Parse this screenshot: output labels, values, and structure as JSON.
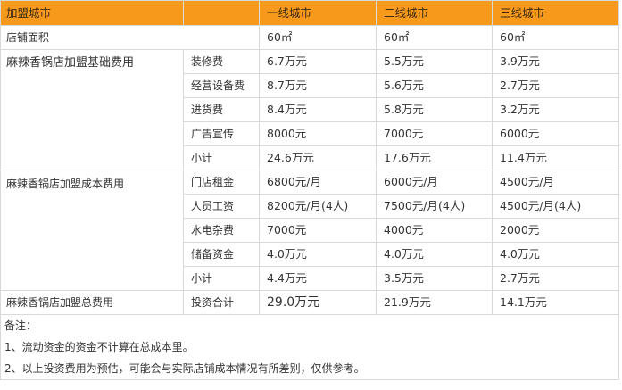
{
  "header": {
    "col0": "加盟城市",
    "col2": "一线城市",
    "col3": "二线城市",
    "col4": "三线城市"
  },
  "area_row": {
    "label": "店铺面积",
    "v1": "60㎡",
    "v2": "60㎡",
    "v3": "60㎡"
  },
  "basic_group": {
    "label": "麻辣香锅店加盟基础费用",
    "rows": [
      {
        "item": "装修费",
        "v1": "6.7万元",
        "v2": "5.5万元",
        "v3": "3.9万元"
      },
      {
        "item": "经营设备费",
        "v1": "8.7万元",
        "v2": "5.6万元",
        "v3": "2.7万元"
      },
      {
        "item": "进货费",
        "v1": "8.4万元",
        "v2": "5.8万元",
        "v3": "3.2万元"
      },
      {
        "item": "广告宣传",
        "v1": "8000元",
        "v2": "7000元",
        "v3": "6000元"
      },
      {
        "item": "小计",
        "v1": "24.6万元",
        "v2": "17.6万元",
        "v3": "11.4万元"
      }
    ]
  },
  "cost_group": {
    "label": "麻辣香锅店加盟成本费用",
    "rows": [
      {
        "item": "门店租金",
        "v1": "6800元/月",
        "v2": "6000元/月",
        "v3": "4500元/月"
      },
      {
        "item": "人员工资",
        "v1": "8200元/月(4人)",
        "v2": "7500元/月(4人)",
        "v3": "4500元/月(4人)"
      },
      {
        "item": "水电杂费",
        "v1": "7000元",
        "v2": "4000元",
        "v3": "2000元"
      },
      {
        "item": "储备资金",
        "v1": "4.0万元",
        "v2": "4.0万元",
        "v3": "4.0万元"
      },
      {
        "item": "小计",
        "v1": "4.4万元",
        "v2": "3.5万元",
        "v3": "2.7万元"
      }
    ]
  },
  "total_row": {
    "label": "麻辣香锅店加盟总费用",
    "item": "投资合计",
    "v1": "29.0万元",
    "v2": "21.9万元",
    "v3": "14.1万元"
  },
  "notes": {
    "title": "备注：",
    "line1": "1、流动资金的资金不计算在总成本里。",
    "line2": "2、以上投资费用为预估，可能会与实际店铺成本情况有所差别，仅供参考。"
  }
}
